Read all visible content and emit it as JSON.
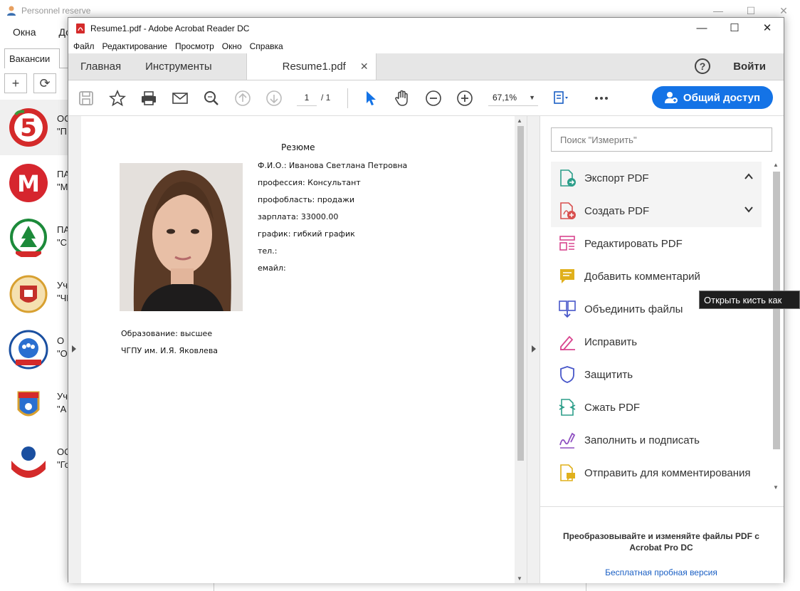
{
  "background_app": {
    "title": "Personnel reserve",
    "window_controls": {
      "minimize": "—",
      "maximize": "☐",
      "close": "✕"
    },
    "menu": [
      "Окна",
      "До"
    ],
    "tab": "Вакансии",
    "toolbar": {
      "add": "+",
      "refresh": "⟳"
    },
    "list": [
      {
        "line1": "ОС",
        "line2": "\"П"
      },
      {
        "line1": "ПА",
        "line2": "\"М"
      },
      {
        "line1": "ПА",
        "line2": "\"С"
      },
      {
        "line1": "Уч",
        "line2": "\"ЧГ"
      },
      {
        "line1": "О",
        "line2": "\"О"
      },
      {
        "line1": "Уч",
        "line2": "\"А"
      },
      {
        "line1": "ОС",
        "line2": "\"Го"
      }
    ]
  },
  "acrobat": {
    "title": "Resume1.pdf - Adobe Acrobat Reader DC",
    "window_controls": {
      "minimize": "—",
      "maximize": "☐",
      "close": "✕"
    },
    "menu": [
      "Файл",
      "Редактирование",
      "Просмотр",
      "Окно",
      "Справка"
    ],
    "tabs": {
      "home": "Главная",
      "tools": "Инструменты",
      "doc": "Resume1.pdf",
      "doc_close": "✕"
    },
    "help": "?",
    "signin": "Войти",
    "toolbar": {
      "page_current": "1",
      "page_total": "/  1",
      "zoom": "67,1%",
      "zoom_caret": "▼",
      "share": "Общий доступ"
    },
    "resume": {
      "title": "Резюме",
      "lines": [
        "Ф.И.О.: Иванова Светлана Петровна",
        "профессия: Консультант",
        "профобласть: продажи",
        "зарплата: 33000.00",
        "график: гибкий график",
        "тел.:",
        "емайл:"
      ],
      "education": "Образование: высшее",
      "institution": "ЧГПУ им. И.Я. Яковлева"
    },
    "tools_pane": {
      "search_placeholder": "Поиск \"Измерить\"",
      "tools": [
        {
          "label": "Экспорт PDF",
          "icon": "export-pdf-icon",
          "color": "#2d9e8a"
        },
        {
          "label": "Создать PDF",
          "icon": "create-pdf-icon",
          "color": "#d8504f"
        },
        {
          "label": "Редактировать PDF",
          "icon": "edit-pdf-icon",
          "color": "#d9468f"
        },
        {
          "label": "Добавить комментарий",
          "icon": "comment-icon",
          "color": "#e0b01c"
        },
        {
          "label": "Объединить файлы",
          "icon": "combine-files-icon",
          "color": "#4857c9"
        },
        {
          "label": "Исправить",
          "icon": "fix-icon",
          "color": "#d9468f"
        },
        {
          "label": "Защитить",
          "icon": "protect-icon",
          "color": "#4857c9"
        },
        {
          "label": "Сжать PDF",
          "icon": "compress-pdf-icon",
          "color": "#2d9e8a"
        },
        {
          "label": "Заполнить и подписать",
          "icon": "fill-sign-icon",
          "color": "#8e4fc1"
        },
        {
          "label": "Отправить для комментирования",
          "icon": "send-comment-icon",
          "color": "#e0b01c"
        }
      ],
      "promo": "Преобразовывайте и изменяйте файлы PDF с Acrobat Pro DC",
      "trial": "Бесплатная пробная версия"
    },
    "tooltip": "Открыть кисть как",
    "accent": "#1473e6"
  }
}
